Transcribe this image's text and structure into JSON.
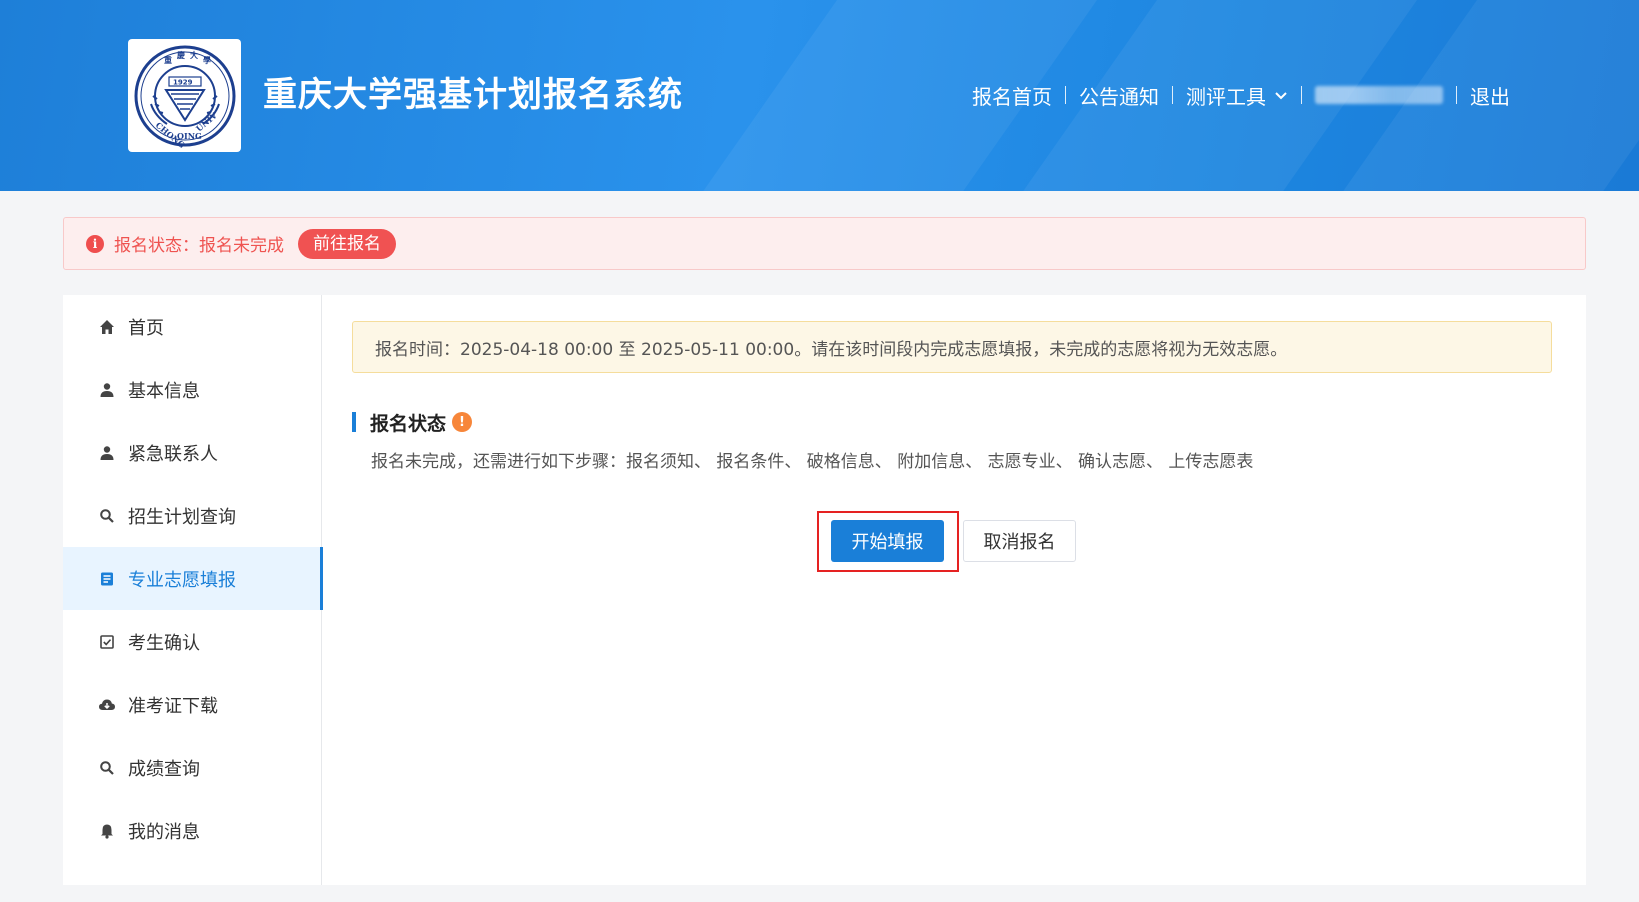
{
  "header": {
    "site_title": "重庆大学强基计划报名系统",
    "nav": {
      "home": "报名首页",
      "notice": "公告通知",
      "tools": "测评工具",
      "logout": "退出"
    }
  },
  "alert": {
    "status_text": "报名状态：报名未完成",
    "go_button": "前往报名"
  },
  "sidebar": {
    "items": [
      {
        "label": "首页",
        "icon": "home-icon"
      },
      {
        "label": "基本信息",
        "icon": "user-icon"
      },
      {
        "label": "紧急联系人",
        "icon": "user-icon"
      },
      {
        "label": "招生计划查询",
        "icon": "search-icon"
      },
      {
        "label": "专业志愿填报",
        "icon": "document-icon",
        "active": true
      },
      {
        "label": "考生确认",
        "icon": "checkbox-icon"
      },
      {
        "label": "准考证下载",
        "icon": "cloud-download-icon"
      },
      {
        "label": "成绩查询",
        "icon": "search-icon"
      },
      {
        "label": "我的消息",
        "icon": "bell-icon"
      }
    ]
  },
  "content": {
    "notice": "报名时间：2025-04-18 00:00 至 2025-05-11 00:00。请在该时间段内完成志愿填报，未完成的志愿将视为无效志愿。",
    "section_title": "报名状态",
    "steps": "报名未完成，还需进行如下步骤：报名须知、 报名条件、 破格信息、 附加信息、 志愿专业、 确认志愿、 上传志愿表",
    "start_button": "开始填报",
    "cancel_button": "取消报名"
  },
  "colors": {
    "primary": "#1a7fd8",
    "header_blue": "#2a92ec",
    "alert_red": "#f05252",
    "warning_orange": "#f7863a"
  }
}
